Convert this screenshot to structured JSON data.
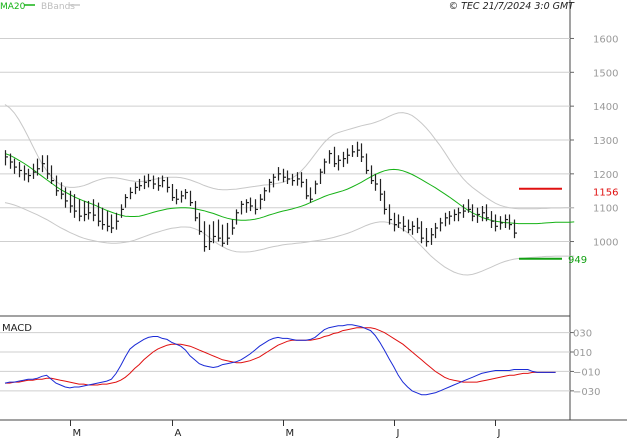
{
  "header": {
    "legend_ma": "MA20",
    "legend_bb": "BBands",
    "copyright": "© TEC 21/7/2024 3:0 GMT"
  },
  "colors": {
    "ma": "#16b216",
    "bands": "#c8c8c8",
    "macd": "#1a2ad6",
    "signal": "#e01010",
    "resistance": "#e01010",
    "support": "#12a012",
    "bars": "#222222",
    "grid": "#cfcfcf",
    "axis_text": "#9a9a9a"
  },
  "price_panel": {
    "resistance": {
      "value": 1156,
      "label": "1156"
    },
    "support": {
      "value": 949,
      "label": "949"
    },
    "ylim": [
      780,
      1690
    ],
    "yticks": [
      {
        "value": 1000,
        "label": "1000"
      },
      {
        "value": 1100,
        "label": "1100"
      },
      {
        "value": 1200,
        "label": "1200"
      },
      {
        "value": 1300,
        "label": "1300"
      },
      {
        "value": 1400,
        "label": "1400"
      },
      {
        "value": 1500,
        "label": "1500"
      },
      {
        "value": 1600,
        "label": "1600"
      }
    ]
  },
  "macd_panel": {
    "title": "MACD",
    "ylim": [
      -60,
      45
    ],
    "yticks": [
      {
        "value": 30,
        "label": "030"
      },
      {
        "value": 10,
        "label": "010"
      },
      {
        "value": -10,
        "label": "−010"
      },
      {
        "value": -30,
        "label": "−030"
      }
    ]
  },
  "x_axis": {
    "months": [
      {
        "index": 14,
        "label": "M"
      },
      {
        "index": 36,
        "label": "A"
      },
      {
        "index": 60,
        "label": "M"
      },
      {
        "index": 84,
        "label": "J"
      },
      {
        "index": 106,
        "label": "J"
      }
    ]
  },
  "chart_data": {
    "type": "line",
    "title": "",
    "series": [
      {
        "name": "MA20",
        "values": [
          1260,
          1255,
          1248,
          1240,
          1232,
          1223,
          1213,
          1203,
          1193,
          1183,
          1173,
          1163,
          1154,
          1146,
          1139,
          1132,
          1126,
          1120,
          1115,
          1110,
          1104,
          1098,
          1092,
          1087,
          1082,
          1078,
          1075,
          1074,
          1074,
          1075,
          1078,
          1082,
          1086,
          1090,
          1093,
          1096,
          1098,
          1099,
          1100,
          1100,
          1099,
          1097,
          1094,
          1091,
          1087,
          1083,
          1078,
          1073,
          1069,
          1066,
          1064,
          1063,
          1063,
          1064,
          1066,
          1069,
          1073,
          1078,
          1082,
          1086,
          1090,
          1093,
          1096,
          1100,
          1104,
          1109,
          1115,
          1121,
          1127,
          1133,
          1138,
          1142,
          1146,
          1150,
          1155,
          1161,
          1168,
          1175,
          1183,
          1191,
          1198,
          1204,
          1209,
          1212,
          1213,
          1212,
          1209,
          1204,
          1198,
          1191,
          1183,
          1175,
          1167,
          1159,
          1150,
          1141,
          1132,
          1122,
          1112,
          1102,
          1093,
          1085,
          1078,
          1072,
          1067,
          1063,
          1060,
          1058,
          1056,
          1055,
          1054,
          1053,
          1053,
          1053,
          1053,
          1053,
          1054,
          1055,
          1056,
          1057,
          1057,
          1057,
          1057,
          1058
        ]
      },
      {
        "name": "BBands",
        "values": [
          1405,
          1395,
          1380,
          1360,
          1336,
          1310,
          1282,
          1255,
          1230,
          1210,
          1192,
          1178,
          1168,
          1162,
          1160,
          1160,
          1162,
          1165,
          1170,
          1176,
          1181,
          1185,
          1188,
          1189,
          1188,
          1186,
          1183,
          1180,
          1178,
          1177,
          1178,
          1180,
          1183,
          1186,
          1188,
          1190,
          1190,
          1190,
          1189,
          1186,
          1182,
          1177,
          1172,
          1166,
          1161,
          1157,
          1154,
          1153,
          1153,
          1154,
          1155,
          1157,
          1159,
          1161,
          1163,
          1165,
          1167,
          1168,
          1170,
          1172,
          1175,
          1180,
          1187,
          1196,
          1208,
          1223,
          1240,
          1258,
          1276,
          1293,
          1306,
          1316,
          1322,
          1326,
          1330,
          1334,
          1338,
          1342,
          1345,
          1348,
          1352,
          1357,
          1363,
          1370,
          1376,
          1380,
          1381,
          1378,
          1372,
          1362,
          1350,
          1336,
          1320,
          1302,
          1284,
          1264,
          1243,
          1222,
          1203,
          1186,
          1172,
          1160,
          1150,
          1140,
          1130,
          1121,
          1113,
          1107,
          1103,
          1100,
          1098,
          1097,
          1097,
          1097,
          1097,
          1097,
          1098,
          1098,
          1099,
          1099,
          1099,
          1100,
          1100,
          1100
        ]
      },
      {
        "name": "BBands-lower",
        "values": [
          1115,
          1112,
          1108,
          1103,
          1097,
          1091,
          1085,
          1079,
          1072,
          1065,
          1057,
          1049,
          1041,
          1034,
          1027,
          1021,
          1015,
          1010,
          1006,
          1003,
          1000,
          998,
          996,
          995,
          995,
          996,
          998,
          1000,
          1004,
          1009,
          1014,
          1019,
          1024,
          1028,
          1032,
          1036,
          1039,
          1041,
          1043,
          1043,
          1042,
          1038,
          1032,
          1024,
          1014,
          1003,
          993,
          985,
          978,
          973,
          970,
          969,
          969,
          970,
          972,
          975,
          978,
          982,
          985,
          987,
          990,
          992,
          993,
          995,
          996,
          998,
          1000,
          1002,
          1004,
          1006,
          1009,
          1012,
          1016,
          1020,
          1024,
          1029,
          1035,
          1041,
          1047,
          1052,
          1056,
          1058,
          1058,
          1056,
          1051,
          1044,
          1036,
          1026,
          1014,
          1000,
          986,
          972,
          958,
          946,
          935,
          925,
          917,
          910,
          905,
          902,
          901,
          903,
          907,
          912,
          918,
          924,
          930,
          936,
          941,
          945,
          948,
          950,
          951,
          952,
          953,
          954,
          955,
          956,
          956,
          957,
          957,
          957,
          957,
          957
        ]
      },
      {
        "name": "MACD",
        "values": [
          -22,
          -21,
          -21,
          -20,
          -19,
          -18,
          -18,
          -17,
          -15,
          -14,
          -18,
          -22,
          -24,
          -26,
          -27,
          -26,
          -26,
          -25,
          -24,
          -23,
          -22,
          -21,
          -20,
          -18,
          -12,
          -4,
          5,
          13,
          17,
          20,
          23,
          25,
          26,
          26,
          24,
          23,
          20,
          18,
          16,
          12,
          6,
          2,
          -2,
          -4,
          -5,
          -6,
          -5,
          -3,
          -2,
          -1,
          0,
          2,
          5,
          8,
          12,
          16,
          19,
          22,
          24,
          25,
          24,
          24,
          23,
          22,
          22,
          22,
          23,
          25,
          29,
          33,
          35,
          36,
          37,
          37,
          38,
          38,
          37,
          36,
          34,
          32,
          27,
          20,
          12,
          3,
          -5,
          -14,
          -21,
          -26,
          -30,
          -32,
          -34,
          -34,
          -33,
          -32,
          -30,
          -28,
          -26,
          -24,
          -22,
          -20,
          -18,
          -16,
          -14,
          -12,
          -11,
          -10,
          -9,
          -9,
          -9,
          -9,
          -8,
          -8,
          -8,
          -8,
          -10,
          -11,
          -11,
          -11,
          -11,
          -11
        ]
      },
      {
        "name": "Signal",
        "values": [
          -22,
          -22,
          -21,
          -21,
          -20,
          -19,
          -19,
          -18,
          -18,
          -17,
          -17,
          -18,
          -19,
          -20,
          -21,
          -22,
          -23,
          -23,
          -24,
          -24,
          -24,
          -23,
          -23,
          -22,
          -21,
          -19,
          -16,
          -12,
          -7,
          -3,
          2,
          6,
          10,
          13,
          15,
          17,
          18,
          18,
          18,
          17,
          16,
          14,
          12,
          10,
          8,
          6,
          4,
          2,
          1,
          0,
          -1,
          -1,
          0,
          1,
          3,
          5,
          8,
          11,
          14,
          17,
          19,
          21,
          22,
          22,
          22,
          22,
          22,
          23,
          24,
          26,
          27,
          29,
          30,
          32,
          33,
          34,
          35,
          35,
          35,
          35,
          34,
          32,
          30,
          27,
          24,
          21,
          18,
          14,
          10,
          6,
          2,
          -2,
          -6,
          -10,
          -13,
          -16,
          -18,
          -19,
          -20,
          -21,
          -21,
          -21,
          -21,
          -20,
          -19,
          -18,
          -17,
          -16,
          -15,
          -14,
          -14,
          -13,
          -12,
          -12,
          -11,
          -11,
          -11,
          -11,
          -11,
          -11
        ]
      }
    ],
    "ohlc": [
      [
        1270,
        1225,
        1250
      ],
      [
        1260,
        1215,
        1235
      ],
      [
        1245,
        1200,
        1220
      ],
      [
        1235,
        1190,
        1210
      ],
      [
        1225,
        1180,
        1200
      ],
      [
        1215,
        1175,
        1195
      ],
      [
        1230,
        1185,
        1205
      ],
      [
        1245,
        1195,
        1215
      ],
      [
        1255,
        1205,
        1230
      ],
      [
        1255,
        1185,
        1200
      ],
      [
        1225,
        1170,
        1180
      ],
      [
        1195,
        1135,
        1150
      ],
      [
        1175,
        1125,
        1140
      ],
      [
        1160,
        1100,
        1120
      ],
      [
        1150,
        1085,
        1105
      ],
      [
        1140,
        1070,
        1090
      ],
      [
        1125,
        1060,
        1075
      ],
      [
        1120,
        1060,
        1080
      ],
      [
        1120,
        1065,
        1085
      ],
      [
        1125,
        1060,
        1078
      ],
      [
        1115,
        1045,
        1060
      ],
      [
        1100,
        1035,
        1050
      ],
      [
        1090,
        1030,
        1045
      ],
      [
        1080,
        1025,
        1040
      ],
      [
        1085,
        1035,
        1060
      ],
      [
        1110,
        1070,
        1095
      ],
      [
        1140,
        1100,
        1130
      ],
      [
        1160,
        1125,
        1145
      ],
      [
        1175,
        1140,
        1160
      ],
      [
        1185,
        1150,
        1165
      ],
      [
        1195,
        1155,
        1175
      ],
      [
        1200,
        1160,
        1180
      ],
      [
        1195,
        1155,
        1170
      ],
      [
        1190,
        1150,
        1165
      ],
      [
        1195,
        1160,
        1180
      ],
      [
        1190,
        1145,
        1160
      ],
      [
        1170,
        1120,
        1130
      ],
      [
        1155,
        1110,
        1125
      ],
      [
        1150,
        1115,
        1135
      ],
      [
        1155,
        1125,
        1145
      ],
      [
        1150,
        1105,
        1115
      ],
      [
        1120,
        1060,
        1070
      ],
      [
        1085,
        1020,
        1030
      ],
      [
        1060,
        970,
        985
      ],
      [
        1050,
        975,
        1000
      ],
      [
        1060,
        995,
        1015
      ],
      [
        1065,
        1000,
        1010
      ],
      [
        1050,
        985,
        995
      ],
      [
        1055,
        990,
        1010
      ],
      [
        1065,
        1020,
        1040
      ],
      [
        1095,
        1050,
        1085
      ],
      [
        1120,
        1080,
        1110
      ],
      [
        1125,
        1085,
        1115
      ],
      [
        1130,
        1090,
        1105
      ],
      [
        1125,
        1080,
        1095
      ],
      [
        1140,
        1095,
        1125
      ],
      [
        1160,
        1120,
        1150
      ],
      [
        1185,
        1145,
        1175
      ],
      [
        1200,
        1160,
        1190
      ],
      [
        1220,
        1180,
        1200
      ],
      [
        1215,
        1175,
        1190
      ],
      [
        1210,
        1170,
        1185
      ],
      [
        1200,
        1165,
        1180
      ],
      [
        1205,
        1165,
        1185
      ],
      [
        1205,
        1160,
        1175
      ],
      [
        1185,
        1125,
        1135
      ],
      [
        1160,
        1115,
        1125
      ],
      [
        1180,
        1140,
        1170
      ],
      [
        1215,
        1170,
        1205
      ],
      [
        1245,
        1200,
        1235
      ],
      [
        1270,
        1230,
        1260
      ],
      [
        1280,
        1220,
        1230
      ],
      [
        1255,
        1210,
        1240
      ],
      [
        1265,
        1220,
        1245
      ],
      [
        1275,
        1230,
        1255
      ],
      [
        1285,
        1250,
        1265
      ],
      [
        1295,
        1250,
        1270
      ],
      [
        1290,
        1235,
        1250
      ],
      [
        1260,
        1200,
        1210
      ],
      [
        1225,
        1170,
        1180
      ],
      [
        1200,
        1150,
        1170
      ],
      [
        1185,
        1120,
        1140
      ],
      [
        1150,
        1080,
        1095
      ],
      [
        1110,
        1050,
        1065
      ],
      [
        1085,
        1030,
        1050
      ],
      [
        1080,
        1040,
        1055
      ],
      [
        1075,
        1030,
        1045
      ],
      [
        1065,
        1025,
        1035
      ],
      [
        1060,
        1020,
        1045
      ],
      [
        1070,
        1025,
        1040
      ],
      [
        1060,
        995,
        1010
      ],
      [
        1040,
        985,
        1000
      ],
      [
        1040,
        990,
        1020
      ],
      [
        1055,
        1010,
        1040
      ],
      [
        1070,
        1030,
        1055
      ],
      [
        1085,
        1045,
        1070
      ],
      [
        1090,
        1050,
        1075
      ],
      [
        1095,
        1060,
        1080
      ],
      [
        1100,
        1060,
        1085
      ],
      [
        1110,
        1070,
        1090
      ],
      [
        1125,
        1085,
        1095
      ],
      [
        1110,
        1060,
        1075
      ],
      [
        1100,
        1055,
        1080
      ],
      [
        1105,
        1060,
        1085
      ],
      [
        1110,
        1060,
        1070
      ],
      [
        1090,
        1040,
        1060
      ],
      [
        1080,
        1030,
        1045
      ],
      [
        1075,
        1035,
        1055
      ],
      [
        1080,
        1040,
        1065
      ],
      [
        1080,
        1035,
        1050
      ],
      [
        1065,
        1010,
        1025
      ]
    ]
  }
}
